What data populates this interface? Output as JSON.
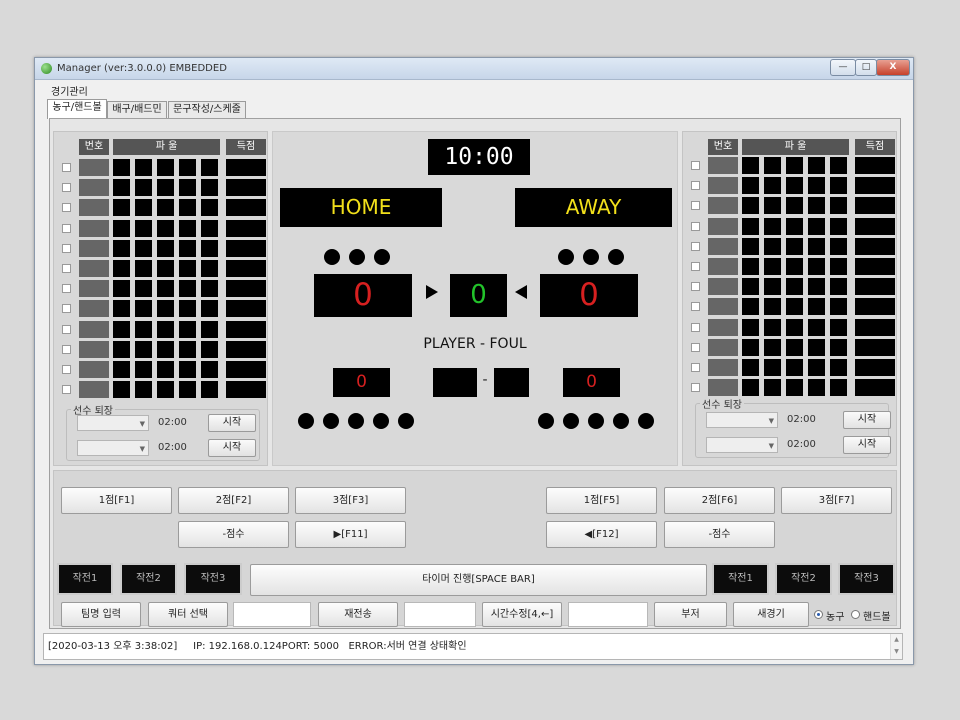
{
  "window": {
    "title": "Manager (ver:3.0.0.0) EMBEDDED",
    "controls": {
      "minimize": "—",
      "maximize": "□",
      "close": "X"
    }
  },
  "menu": {
    "game_management": "경기관리"
  },
  "tabs": [
    {
      "label": "농구/핸드볼",
      "active": true
    },
    {
      "label": "배구/배드민",
      "active": false
    },
    {
      "label": "문구작성/스케줄",
      "active": false
    }
  ],
  "player_table": {
    "col_number": "번호",
    "col_foul": "파 울",
    "col_points": "득점",
    "rows": 12,
    "foul_cells": 5
  },
  "player_exit": {
    "legend": "선수 퇴장",
    "time1": "02:00",
    "time2": "02:00",
    "start_label": "시작"
  },
  "scoreboard": {
    "timer": "10:00",
    "home_label": "HOME",
    "away_label": "AWAY",
    "home_score": "0",
    "away_score": "0",
    "quarter": "0",
    "player_foul_label": "PLAYER - FOUL",
    "home_foul": "0",
    "away_foul": "0",
    "foul_dash": "-",
    "home_timeout_dots": 3,
    "away_timeout_dots": 3,
    "home_foul_dots": 5,
    "away_foul_dots": 5
  },
  "controls": {
    "home_1pt": "1점[F1]",
    "home_2pt": "2점[F2]",
    "home_3pt": "3점[F3]",
    "home_minus": "-점수",
    "home_poss": "▶[F11]",
    "away_1pt": "1점[F5]",
    "away_2pt": "2점[F6]",
    "away_3pt": "3점[F7]",
    "away_minus": "-점수",
    "away_poss": "◀[F12]",
    "home_timeout1": "작전1",
    "home_timeout2": "작전2",
    "home_timeout3": "작전3",
    "timer_run": "타이머 진행[SPACE BAR]",
    "away_timeout1": "작전1",
    "away_timeout2": "작전2",
    "away_timeout3": "작전3",
    "team_name": "팀명 입력",
    "quarter_select": "쿼터 선택",
    "resend": "재전송",
    "time_edit": "시간수정[4,←]",
    "buzzer": "부저",
    "new_game": "새경기",
    "radio_basketball": "농구",
    "radio_handball": "핸드볼"
  },
  "status": {
    "line": "[2020-03-13 오후 3:38:02]     IP: 192.168.0.124PORT: 5000   ERROR:서버 연결 상태확인"
  }
}
